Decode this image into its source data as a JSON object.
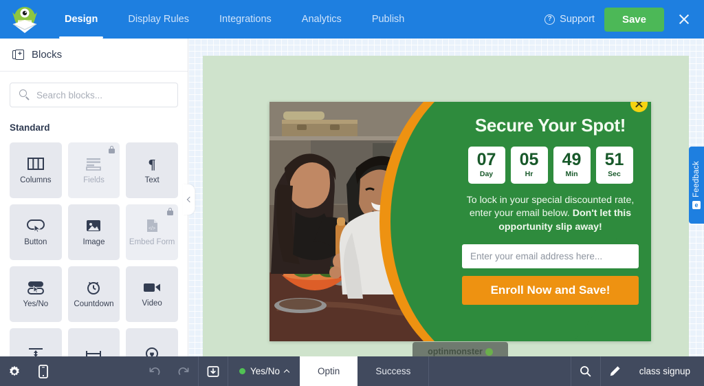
{
  "topnav": {
    "logo_icon": "optinmonster-mascot-logo",
    "items": [
      {
        "label": "Design",
        "active": true
      },
      {
        "label": "Display Rules",
        "active": false
      },
      {
        "label": "Integrations",
        "active": false
      },
      {
        "label": "Analytics",
        "active": false
      },
      {
        "label": "Publish",
        "active": false
      }
    ],
    "support_label": "Support",
    "support_icon": "question-circle-icon",
    "save_label": "Save",
    "close_icon": "close-icon",
    "bg_color": "#1e7fe0",
    "save_color": "#4cb857"
  },
  "sidebar": {
    "title": "Blocks",
    "title_icon": "add-block-icon",
    "search": {
      "value": "",
      "placeholder": "Search blocks...",
      "icon": "search-icon"
    },
    "section_label": "Standard",
    "blocks": [
      {
        "label": "Columns",
        "icon": "columns-icon",
        "locked": false
      },
      {
        "label": "Fields",
        "icon": "fields-icon",
        "locked": true
      },
      {
        "label": "Text",
        "icon": "text-paragraph-icon",
        "locked": false
      },
      {
        "label": "Button",
        "icon": "button-icon",
        "locked": false
      },
      {
        "label": "Image",
        "icon": "image-icon",
        "locked": false
      },
      {
        "label": "Embed Form",
        "icon": "embed-form-icon",
        "locked": true
      },
      {
        "label": "Yes/No",
        "icon": "yes-no-icon",
        "locked": false
      },
      {
        "label": "Countdown",
        "icon": "countdown-clock-icon",
        "locked": false
      },
      {
        "label": "Video",
        "icon": "video-camera-icon",
        "locked": false
      },
      {
        "label": "",
        "icon": "spacer-icon",
        "locked": false
      },
      {
        "label": "",
        "icon": "divider-icon",
        "locked": false
      },
      {
        "label": "",
        "icon": "social-heart-icon",
        "locked": false
      }
    ],
    "collapse_icon": "chevron-left-icon"
  },
  "popup": {
    "close_icon": "close-icon",
    "headline": "Secure Your Spot!",
    "countdown": [
      {
        "value": "07",
        "unit": "Day"
      },
      {
        "value": "05",
        "unit": "Hr"
      },
      {
        "value": "49",
        "unit": "Min"
      },
      {
        "value": "51",
        "unit": "Sec"
      }
    ],
    "body_normal": "To lock in your special discounted rate, enter your email below. ",
    "body_bold": "Don't let this opportunity slip away!",
    "email_placeholder": "Enter your email address here...",
    "email_value": "",
    "cta_label": "Enroll Now and Save!",
    "badge_text": "optinmonster",
    "green": "#2e8b3d",
    "orange": "#ee9211",
    "close_yellow": "#f5d311"
  },
  "feedback": {
    "label": "Feedback",
    "icon": "feedback-icon"
  },
  "bottombar": {
    "settings_icon": "gear-icon",
    "mobile_icon": "mobile-device-icon",
    "undo_icon": "undo-icon",
    "redo_icon": "redo-icon",
    "save_template_icon": "save-template-icon",
    "state_label": "Yes/No",
    "state_chevron_icon": "chevron-up-icon",
    "tabs": [
      {
        "label": "Optin",
        "active": true
      },
      {
        "label": "Success",
        "active": false
      }
    ],
    "search_icon": "search-icon",
    "edit_icon": "pencil-edit-icon",
    "campaign_name": "class signup"
  }
}
